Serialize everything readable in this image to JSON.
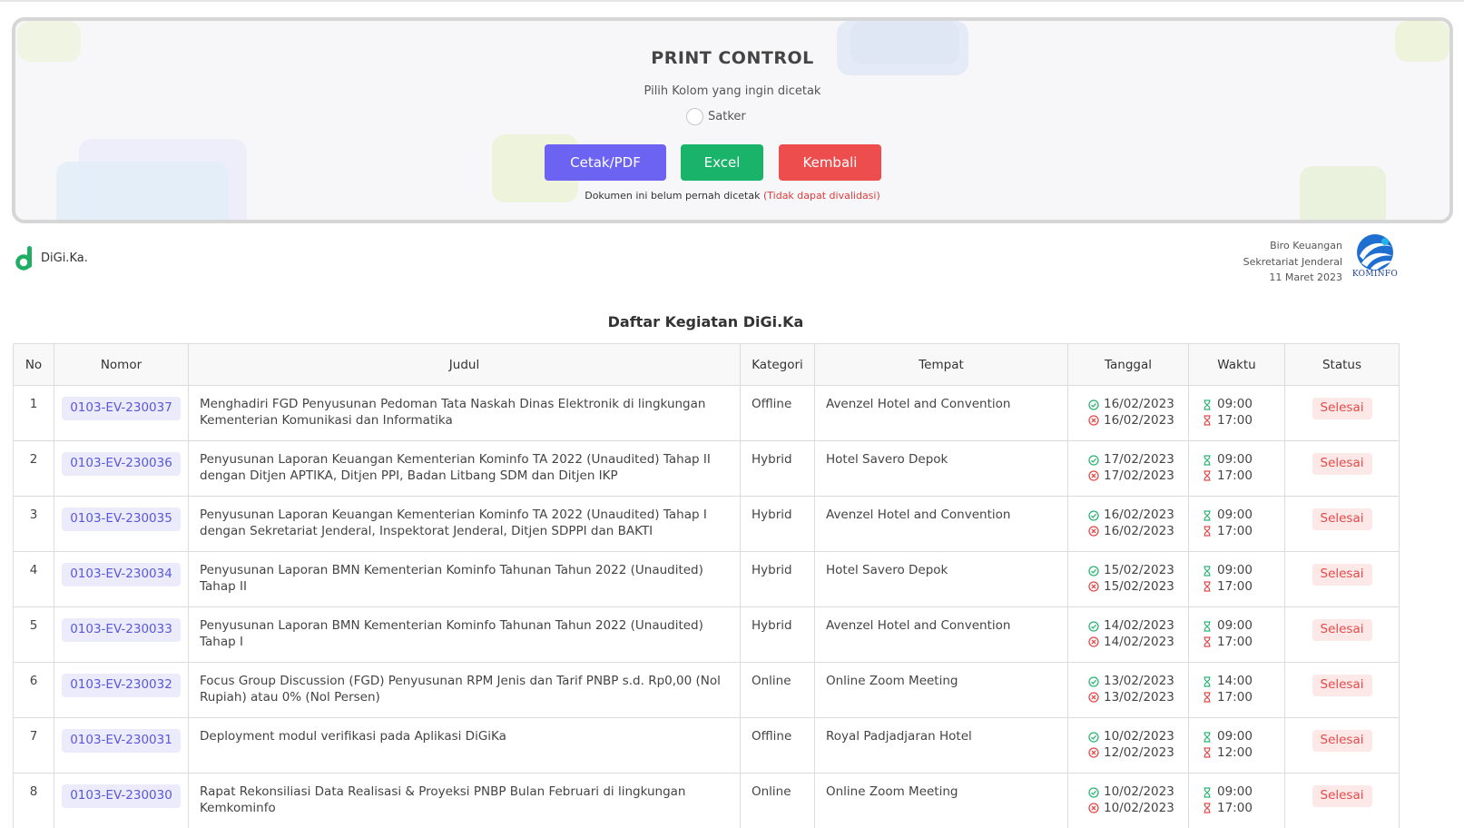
{
  "print_control": {
    "title": "PRINT CONTROL",
    "subtitle": "Pilih Kolom yang ingin dicetak",
    "checkbox_label": "Satker",
    "buttons": {
      "pdf": "Cetak/PDF",
      "excel": "Excel",
      "back": "Kembali"
    },
    "note": "Dokumen ini belum pernah dicetak",
    "note_warning": "(Tidak dapat divalidasi)"
  },
  "header": {
    "brand": "DiGi.Ka.",
    "org_line1": "Biro Keuangan",
    "org_line2": "Sekretariat Jenderal",
    "date": "11 Maret 2023",
    "logo_text": "KOMINFO"
  },
  "list_title": "Daftar Kegiatan DiGi.Ka",
  "table": {
    "headers": {
      "no": "No",
      "nomor": "Nomor",
      "judul": "Judul",
      "kategori": "Kategori",
      "tempat": "Tempat",
      "tanggal": "Tanggal",
      "waktu": "Waktu",
      "status": "Status"
    },
    "rows": [
      {
        "no": "1",
        "nomor": "0103-EV-230037",
        "judul": "Menghadiri FGD Penyusunan Pedoman Tata Naskah Dinas Elektronik di lingkungan Kementerian Komunikasi dan Informatika",
        "kategori": "Offline",
        "tempat": "Avenzel Hotel and Convention",
        "tgl_mulai": "16/02/2023",
        "tgl_selesai": "16/02/2023",
        "jam_mulai": "09:00",
        "jam_selesai": "17:00",
        "status": "Selesai"
      },
      {
        "no": "2",
        "nomor": "0103-EV-230036",
        "judul": "Penyusunan Laporan Keuangan Kementerian Kominfo TA 2022 (Unaudited) Tahap II dengan Ditjen APTIKA, Ditjen PPI, Badan Litbang SDM dan Ditjen IKP",
        "kategori": "Hybrid",
        "tempat": "Hotel Savero Depok",
        "tgl_mulai": "17/02/2023",
        "tgl_selesai": "17/02/2023",
        "jam_mulai": "09:00",
        "jam_selesai": "17:00",
        "status": "Selesai"
      },
      {
        "no": "3",
        "nomor": "0103-EV-230035",
        "judul": "Penyusunan Laporan Keuangan Kementerian Kominfo TA 2022 (Unaudited) Tahap I dengan Sekretariat Jenderal, Inspektorat Jenderal, Ditjen SDPPI dan BAKTI",
        "kategori": "Hybrid",
        "tempat": "Avenzel Hotel and Convention",
        "tgl_mulai": "16/02/2023",
        "tgl_selesai": "16/02/2023",
        "jam_mulai": "09:00",
        "jam_selesai": "17:00",
        "status": "Selesai"
      },
      {
        "no": "4",
        "nomor": "0103-EV-230034",
        "judul": "Penyusunan Laporan BMN Kementerian Kominfo Tahunan Tahun 2022 (Unaudited) Tahap II",
        "kategori": "Hybrid",
        "tempat": "Hotel Savero Depok",
        "tgl_mulai": "15/02/2023",
        "tgl_selesai": "15/02/2023",
        "jam_mulai": "09:00",
        "jam_selesai": "17:00",
        "status": "Selesai"
      },
      {
        "no": "5",
        "nomor": "0103-EV-230033",
        "judul": "Penyusunan Laporan BMN Kementerian Kominfo Tahunan Tahun 2022 (Unaudited) Tahap I",
        "kategori": "Hybrid",
        "tempat": "Avenzel Hotel and Convention",
        "tgl_mulai": "14/02/2023",
        "tgl_selesai": "14/02/2023",
        "jam_mulai": "09:00",
        "jam_selesai": "17:00",
        "status": "Selesai"
      },
      {
        "no": "6",
        "nomor": "0103-EV-230032",
        "judul": "Focus Group Discussion (FGD) Penyusunan RPM Jenis dan Tarif PNBP s.d. Rp0,00 (Nol Rupiah) atau 0% (Nol Persen)",
        "kategori": "Online",
        "tempat": "Online Zoom Meeting",
        "tgl_mulai": "13/02/2023",
        "tgl_selesai": "13/02/2023",
        "jam_mulai": "14:00",
        "jam_selesai": "17:00",
        "status": "Selesai"
      },
      {
        "no": "7",
        "nomor": "0103-EV-230031",
        "judul": "Deployment modul verifikasi pada Aplikasi DiGiKa",
        "kategori": "Offline",
        "tempat": "Royal Padjadjaran Hotel",
        "tgl_mulai": "10/02/2023",
        "tgl_selesai": "12/02/2023",
        "jam_mulai": "09:00",
        "jam_selesai": "12:00",
        "status": "Selesai"
      },
      {
        "no": "8",
        "nomor": "0103-EV-230030",
        "judul": "Rapat Rekonsiliasi Data Realisasi & Proyeksi PNBP Bulan Februari di lingkungan Kemkominfo",
        "kategori": "Online",
        "tempat": "Online Zoom Meeting",
        "tgl_mulai": "10/02/2023",
        "tgl_selesai": "10/02/2023",
        "jam_mulai": "09:00",
        "jam_selesai": "17:00",
        "status": "Selesai"
      }
    ]
  },
  "colors": {
    "accent": "#6c63f2",
    "excel": "#19b46a",
    "danger": "#ee4d4d",
    "start": "#2bb673",
    "end": "#e34a4a"
  }
}
